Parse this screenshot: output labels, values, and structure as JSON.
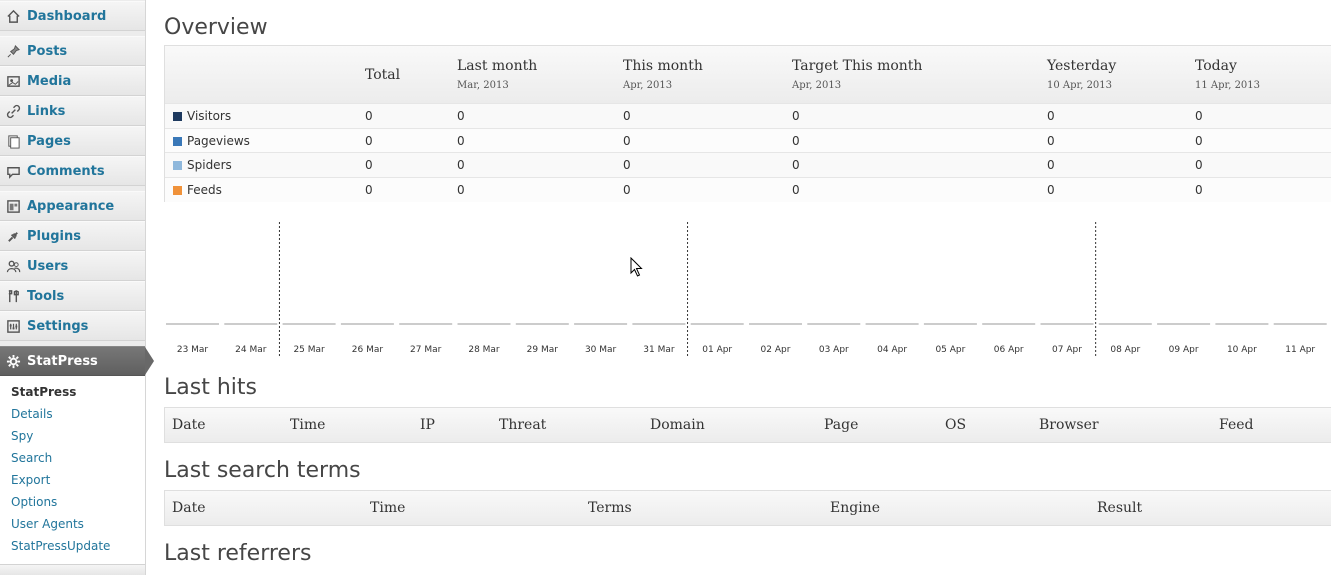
{
  "sidebar": {
    "items": [
      {
        "label": "Dashboard",
        "icon": "dashboard-icon"
      },
      {
        "label": "Posts",
        "icon": "pin-icon"
      },
      {
        "label": "Media",
        "icon": "media-icon"
      },
      {
        "label": "Links",
        "icon": "link-icon"
      },
      {
        "label": "Pages",
        "icon": "pages-icon"
      },
      {
        "label": "Comments",
        "icon": "comment-icon"
      },
      {
        "label": "Appearance",
        "icon": "appearance-icon"
      },
      {
        "label": "Plugins",
        "icon": "plug-icon"
      },
      {
        "label": "Users",
        "icon": "users-icon"
      },
      {
        "label": "Tools",
        "icon": "tools-icon"
      },
      {
        "label": "Settings",
        "icon": "settings-icon"
      },
      {
        "label": "StatPress",
        "icon": "gear-icon"
      }
    ],
    "submenu": [
      "StatPress",
      "Details",
      "Spy",
      "Search",
      "Export",
      "Options",
      "User Agents",
      "StatPressUpdate"
    ]
  },
  "overview": {
    "title": "Overview",
    "columns": [
      {
        "title": "",
        "sub": ""
      },
      {
        "title": "Total",
        "sub": ""
      },
      {
        "title": "Last month",
        "sub": "Mar, 2013"
      },
      {
        "title": "This month",
        "sub": "Apr, 2013"
      },
      {
        "title": "Target This month",
        "sub": "Apr, 2013"
      },
      {
        "title": "Yesterday",
        "sub": "10 Apr, 2013"
      },
      {
        "title": "Today",
        "sub": "11 Apr, 2013"
      }
    ],
    "rows": [
      {
        "label": "Visitors",
        "color": "#1e3a5f",
        "values": [
          "0",
          "0",
          "0",
          "0",
          "0",
          "0"
        ]
      },
      {
        "label": "Pageviews",
        "color": "#3a78b8",
        "values": [
          "0",
          "0",
          "0",
          "0",
          "0",
          "0"
        ]
      },
      {
        "label": "Spiders",
        "color": "#8fb8dc",
        "values": [
          "0",
          "0",
          "0",
          "0",
          "0",
          "0"
        ]
      },
      {
        "label": "Feeds",
        "color": "#f0923a",
        "values": [
          "0",
          "0",
          "0",
          "0",
          "0",
          "0"
        ]
      }
    ]
  },
  "chart_data": {
    "type": "bar",
    "categories": [
      "23 Mar",
      "24 Mar",
      "25 Mar",
      "26 Mar",
      "27 Mar",
      "28 Mar",
      "29 Mar",
      "30 Mar",
      "31 Mar",
      "01 Apr",
      "02 Apr",
      "03 Apr",
      "04 Apr",
      "05 Apr",
      "06 Apr",
      "07 Apr",
      "08 Apr",
      "09 Apr",
      "10 Apr",
      "11 Apr"
    ],
    "values": [
      0,
      0,
      0,
      0,
      0,
      0,
      0,
      0,
      0,
      0,
      0,
      0,
      0,
      0,
      0,
      0,
      0,
      0,
      0,
      0
    ],
    "week_separators_before": [
      "25 Mar",
      "01 Apr",
      "08 Apr"
    ],
    "ylim": [
      0,
      1
    ],
    "grid": false,
    "baseline_color": "#999999"
  },
  "last_hits": {
    "title": "Last hits",
    "columns": [
      "Date",
      "Time",
      "IP",
      "Threat",
      "Domain",
      "Page",
      "OS",
      "Browser",
      "Feed"
    ]
  },
  "last_search": {
    "title": "Last search terms",
    "columns": [
      "Date",
      "Time",
      "Terms",
      "Engine",
      "Result"
    ]
  },
  "last_referrers": {
    "title": "Last referrers"
  }
}
